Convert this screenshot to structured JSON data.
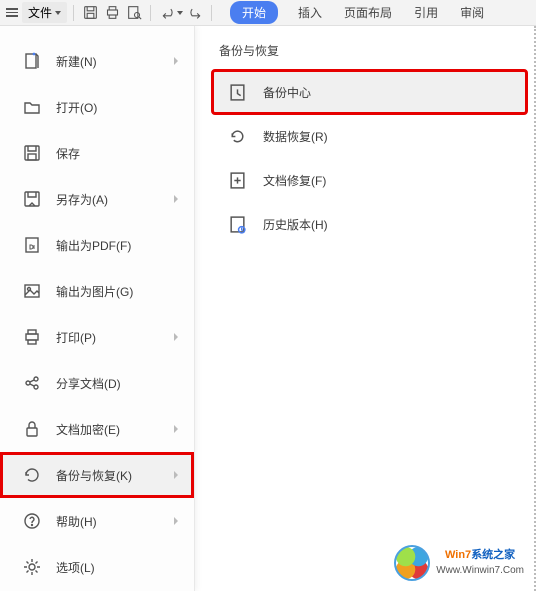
{
  "topbar": {
    "file_label": "文件",
    "tabs": [
      {
        "label": "开始",
        "active": true
      },
      {
        "label": "插入"
      },
      {
        "label": "页面布局"
      },
      {
        "label": "引用"
      },
      {
        "label": "审阅"
      }
    ]
  },
  "file_menu": {
    "items": [
      {
        "label": "新建(N)",
        "name": "new",
        "submenu": true
      },
      {
        "label": "打开(O)",
        "name": "open",
        "submenu": false
      },
      {
        "label": "保存",
        "name": "save",
        "submenu": false
      },
      {
        "label": "另存为(A)",
        "name": "save-as",
        "submenu": true
      },
      {
        "label": "输出为PDF(F)",
        "name": "export-pdf",
        "submenu": false
      },
      {
        "label": "输出为图片(G)",
        "name": "export-image",
        "submenu": false
      },
      {
        "label": "打印(P)",
        "name": "print",
        "submenu": true
      },
      {
        "label": "分享文档(D)",
        "name": "share",
        "submenu": false
      },
      {
        "label": "文档加密(E)",
        "name": "encrypt",
        "submenu": true
      },
      {
        "label": "备份与恢复(K)",
        "name": "backup-restore",
        "submenu": true,
        "highlight": true,
        "red_box": true
      },
      {
        "label": "帮助(H)",
        "name": "help",
        "submenu": true
      },
      {
        "label": "选项(L)",
        "name": "options",
        "submenu": false
      }
    ]
  },
  "sub_panel": {
    "title": "备份与恢复",
    "items": [
      {
        "label": "备份中心",
        "name": "backup-center",
        "highlight": true,
        "red_box": true
      },
      {
        "label": "数据恢复(R)",
        "name": "data-recovery"
      },
      {
        "label": "文档修复(F)",
        "name": "doc-repair"
      },
      {
        "label": "历史版本(H)",
        "name": "history-versions"
      }
    ]
  },
  "watermark": {
    "line1_a": "Win7",
    "line1_b": "系统之家",
    "line2": "Www.Winwin7.Com"
  }
}
